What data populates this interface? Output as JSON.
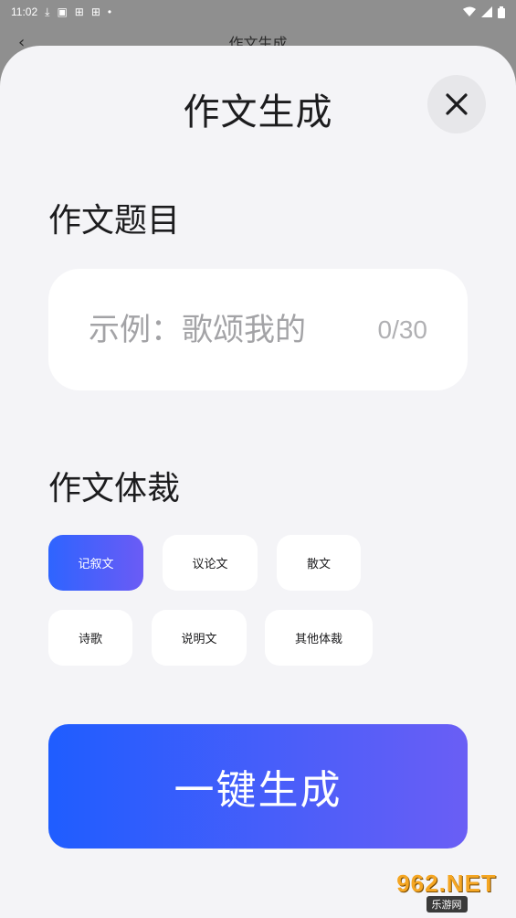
{
  "status_bar": {
    "time": "11:02"
  },
  "background_page": {
    "title": "作文生成",
    "back_glyph": "‹"
  },
  "sheet": {
    "title": "作文生成",
    "close_icon": "close-icon",
    "topic_section": {
      "label": "作文题目",
      "placeholder": "示例：歌颂我的",
      "counter": "0/30"
    },
    "genre_section": {
      "label": "作文体裁",
      "options": [
        {
          "label": "记叙文",
          "selected": true
        },
        {
          "label": "议论文",
          "selected": false
        },
        {
          "label": "散文",
          "selected": false
        },
        {
          "label": "诗歌",
          "selected": false
        },
        {
          "label": "说明文",
          "selected": false
        },
        {
          "label": "其他体裁",
          "selected": false
        }
      ]
    },
    "generate_button": "一键生成"
  },
  "watermark": {
    "main": "962.NET",
    "sub": "乐游网"
  },
  "colors": {
    "accent_start": "#1f5dff",
    "accent_end": "#6a5ef5",
    "sheet_bg": "#f4f4f7",
    "card_bg": "#ffffff"
  }
}
